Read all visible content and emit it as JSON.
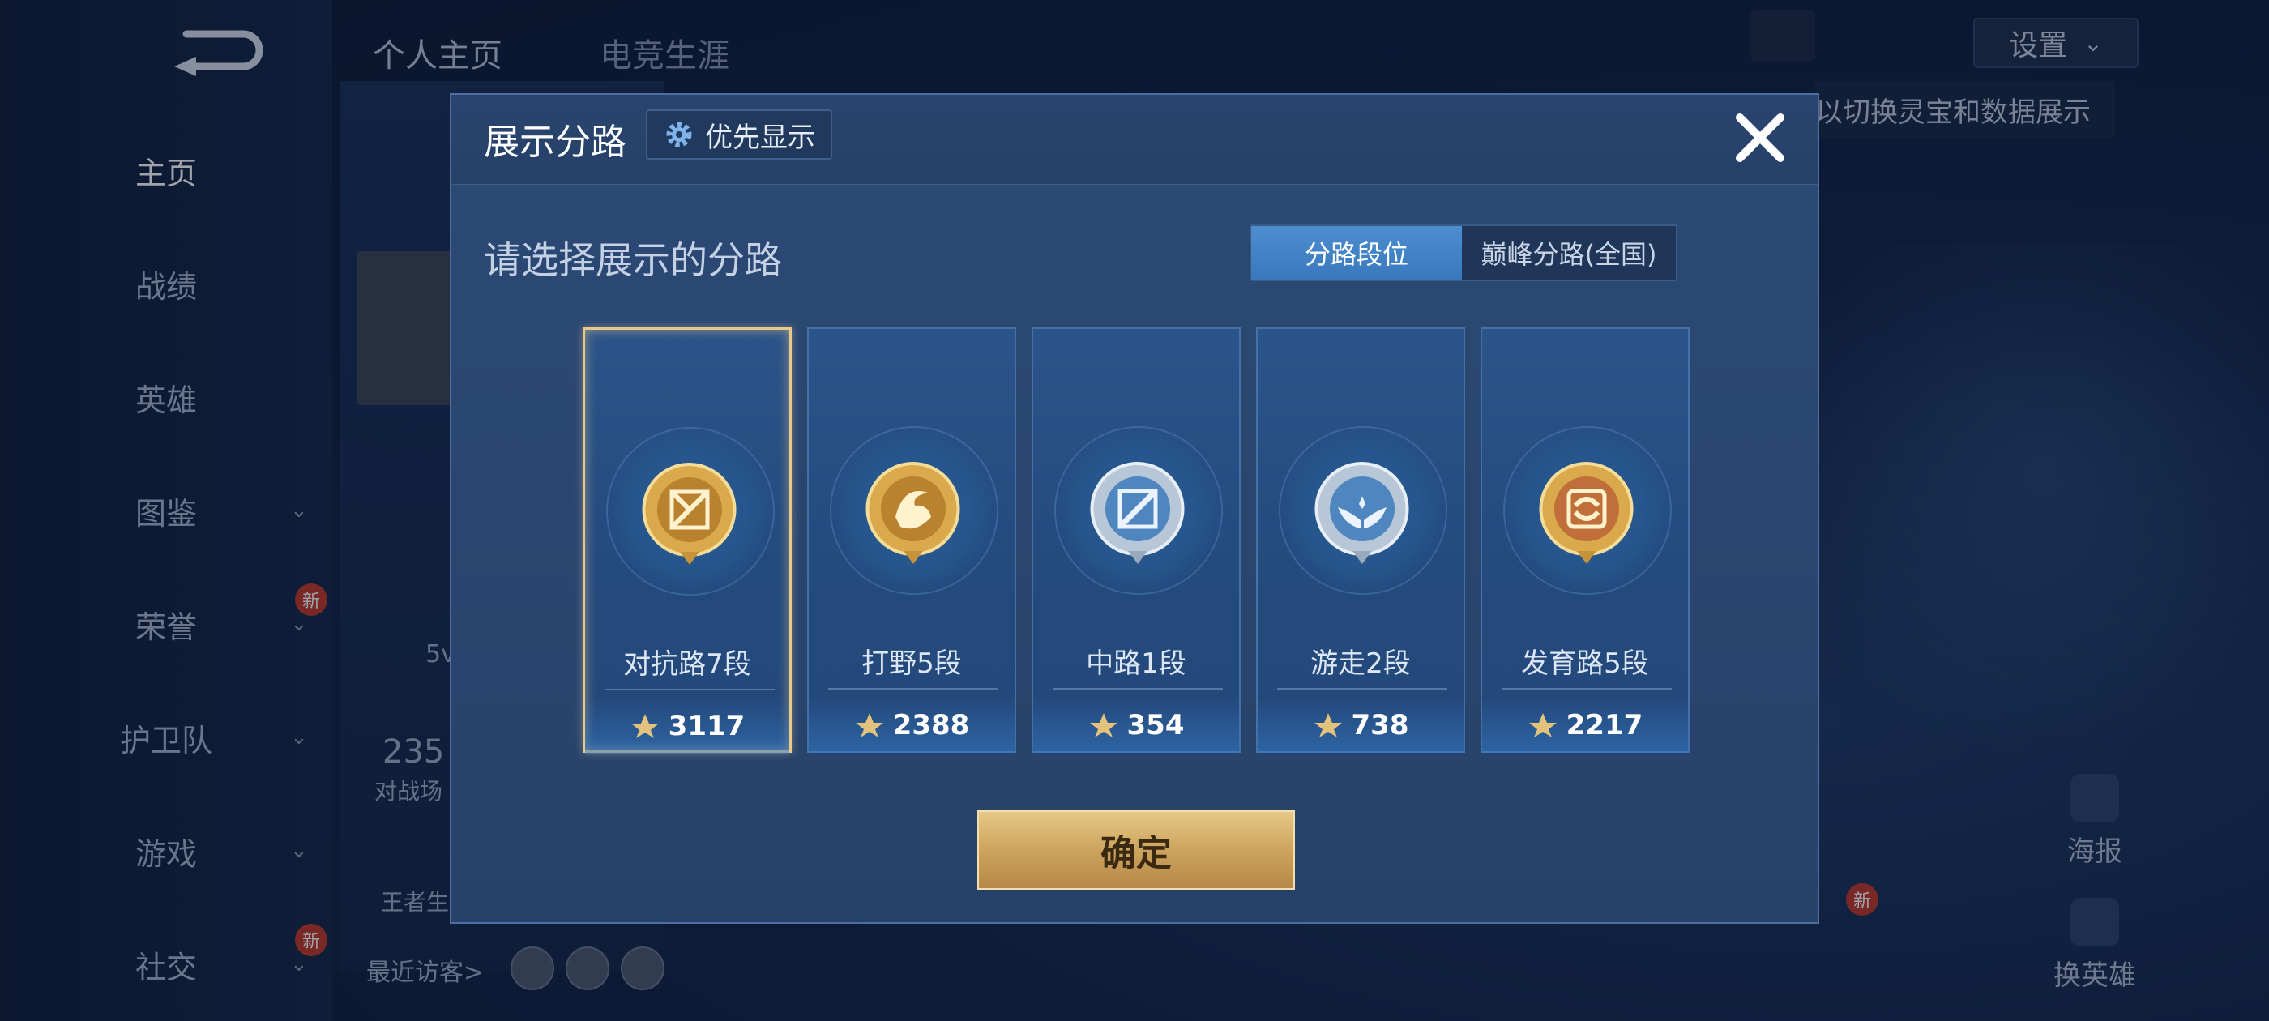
{
  "colors": {
    "accent_blue": "#3a78bd",
    "gold": "#e7c987",
    "panel": "#2a4670"
  },
  "sidebar": {
    "back_icon": "back-arrow-icon",
    "items": [
      {
        "label": "主页",
        "active": true
      },
      {
        "label": "战绩"
      },
      {
        "label": "英雄"
      },
      {
        "label": "图鉴",
        "has_chevron": true
      },
      {
        "label": "荣誉",
        "has_chevron": true,
        "badge": "新"
      },
      {
        "label": "护卫队",
        "has_chevron": true
      },
      {
        "label": "游戏",
        "has_chevron": true
      },
      {
        "label": "社交",
        "has_chevron": true,
        "badge": "新"
      }
    ]
  },
  "header": {
    "tabs": [
      "个人主页",
      "电竞生涯"
    ],
    "settings_label": "设置"
  },
  "background": {
    "hint_text": "以切换灵宝和数据展示",
    "stat_value": "235",
    "stat_label": "对战场",
    "mode_text": "5v",
    "king_text": "王者生",
    "visitors_label": "最近访客>",
    "poster_label": "海报",
    "switch_hero_label": "换英雄",
    "new_badge": "新"
  },
  "modal": {
    "title": "展示分路",
    "priority_label": "优先显示",
    "subtitle": "请选择展示的分路",
    "toggle": {
      "options": [
        "分路段位",
        "巅峰分路(全国)"
      ],
      "active_index": 0
    },
    "lanes": [
      {
        "name": "对抗路7段",
        "score": "3117",
        "icon": "clash-lane-emblem-icon",
        "selected": true
      },
      {
        "name": "打野5段",
        "score": "2388",
        "icon": "jungle-dragon-emblem-icon"
      },
      {
        "name": "中路1段",
        "score": "354",
        "icon": "mid-lane-emblem-icon"
      },
      {
        "name": "游走2段",
        "score": "738",
        "icon": "roam-wings-emblem-icon"
      },
      {
        "name": "发育路5段",
        "score": "2217",
        "icon": "farm-lane-emblem-icon"
      }
    ],
    "confirm_label": "确定"
  }
}
